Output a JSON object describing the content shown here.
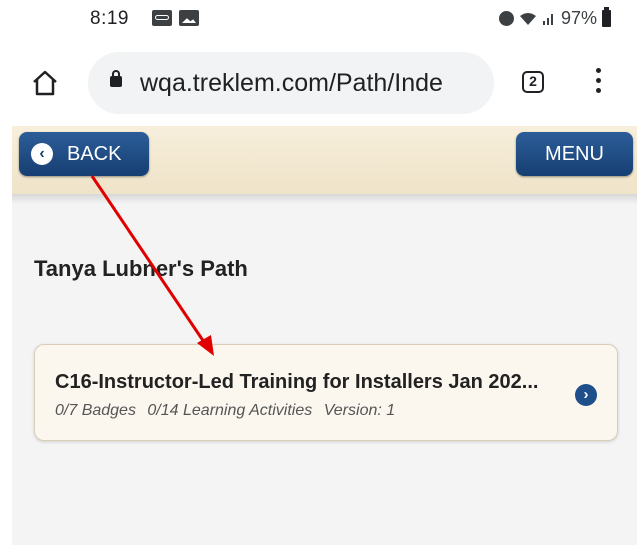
{
  "status_bar": {
    "time": "8:19",
    "battery": "97%",
    "icons": [
      "voicemail-icon",
      "gallery-icon",
      "alarm-icon",
      "wifi-icon",
      "signal-icon",
      "battery-icon"
    ]
  },
  "browser": {
    "url": "wqa.treklem.com/Path/Inde",
    "tab_count": "2"
  },
  "header": {
    "back_label": "BACK",
    "menu_label": "MENU"
  },
  "page": {
    "title": "Tanya Lubner's Path",
    "card": {
      "title": "C16-Instructor-Led Training for Installers Jan 202...",
      "badges": "0/7 Badges",
      "activities": "0/14 Learning Activities",
      "version": "Version: 1"
    }
  },
  "colors": {
    "button_blue": "#163f73",
    "header_beige": "#f3e9d2",
    "annotation_red": "#e00000"
  }
}
